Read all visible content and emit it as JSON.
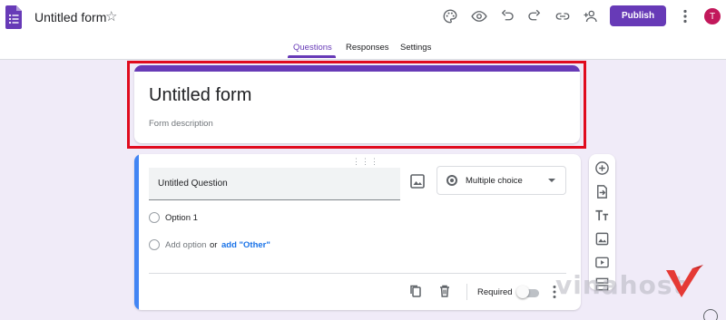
{
  "app": {
    "title": "Untitled form",
    "publish_label": "Publish",
    "avatar_initial": "T",
    "toolbar_icons": [
      "palette-icon",
      "preview-icon",
      "undo-icon",
      "redo-icon",
      "link-icon",
      "add-collaborator-icon"
    ]
  },
  "tabs": [
    {
      "label": "Questions",
      "active": true
    },
    {
      "label": "Responses",
      "active": false
    },
    {
      "label": "Settings",
      "active": false
    }
  ],
  "form": {
    "title": "Untitled form",
    "description_placeholder": "Form description"
  },
  "question": {
    "title": "Untitled Question",
    "type_label": "Multiple choice",
    "options": [
      "Option 1"
    ],
    "add_option_label": "Add option",
    "or_label": "or",
    "add_other_label": "add \"Other\"",
    "required_label": "Required",
    "required": false
  },
  "side_toolbar": [
    "add-question-icon",
    "import-questions-icon",
    "add-title-icon",
    "add-image-icon",
    "add-video-icon",
    "add-section-icon"
  ],
  "watermark": {
    "text": "vinahost"
  },
  "colors": {
    "accent": "#673ab7",
    "focus": "#4285f4",
    "highlight": "#e00b1e",
    "background": "#f0ebf8",
    "link": "#1a73e8"
  }
}
